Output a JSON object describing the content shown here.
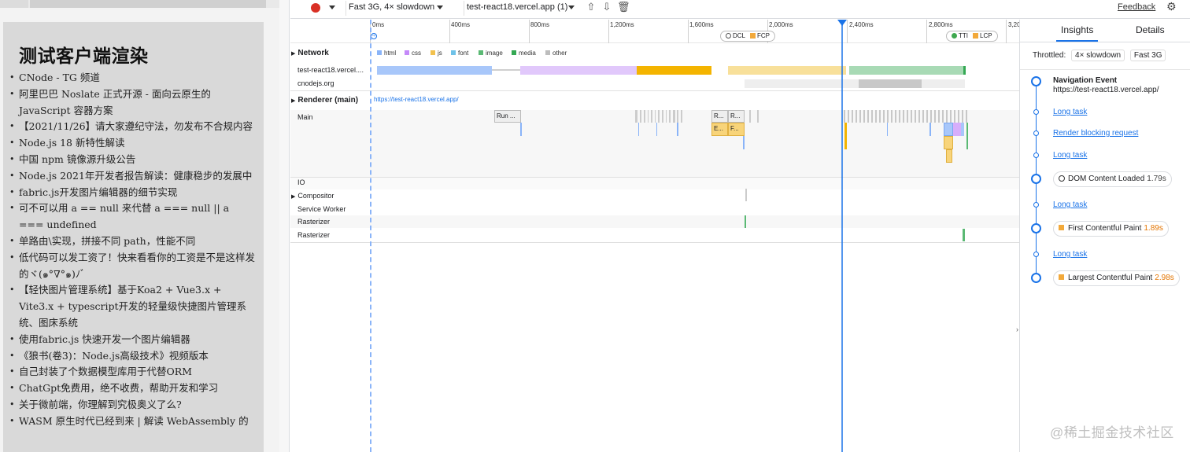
{
  "left_page": {
    "heading": "测试客户端渲染",
    "items": [
      "CNode - TG 频道",
      "阿里巴巴 Noslate 正式开源 - 面向云原生的 JavaScript 容器方案",
      "【2021/11/26】请大家遵纪守法，勿发布不合规内容",
      "Node.js 18 新特性解读",
      "中国 npm 镜像源升级公告",
      "Node.js 2021年开发者报告解读：健康稳步的发展中",
      "fabric.js开发图片编辑器的细节实现",
      "可不可以用 a == null 来代替 a === null || a === undefined",
      "单路由\\实现，拼接不同 path，性能不同",
      "低代码可以发工资了！快来看看你的工资是不是这样发的ヾ(๑°∇°๑)ﾉﾞ",
      "【轻快图片管理系统】基于Koa2 + Vue3.x + Vite3.x + typescript开发的轻量级快捷图片管理系统、图床系统",
      "使用fabric.js 快速开发一个图片编辑器",
      "《狼书(卷3)：Node.js高级技术》视频版本",
      "自己封装了个数据模型库用于代替ORM",
      "ChatGpt免费用，绝不收费，帮助开发和学习",
      "关于微前端，你理解到究极奥义了么?",
      "WASM 原生时代已经到来 | 解读 WebAssembly 的"
    ]
  },
  "toolbar": {
    "throttle_select": "Fast 3G, 4× slowdown",
    "target_select": "test-react18.vercel.app (1)",
    "feedback": "Feedback"
  },
  "ruler": {
    "ticks": [
      "0ms",
      "400ms",
      "800ms",
      "1,200ms",
      "1,600ms",
      "2,000ms",
      "2,400ms",
      "2,800ms",
      "3,20"
    ],
    "dcl_label": "DCL",
    "fcp_label": "FCP",
    "tti_label": "TTI",
    "lcp_label": "LCP"
  },
  "tracks": {
    "network_header": "Network",
    "legend": [
      "html",
      "css",
      "js",
      "font",
      "image",
      "media",
      "other"
    ],
    "legend_colors": [
      "#8ab4f8",
      "#c58af9",
      "#f2c14e",
      "#6fc2e8",
      "#5bb974",
      "#34a853",
      "#bdbdbd"
    ],
    "net_rows": [
      "test-react18.vercel....",
      "cnodejs.org"
    ],
    "renderer_header": "Renderer (main)",
    "renderer_url": "https://test-react18.vercel.app/",
    "main_label": "Main",
    "run_task": "Run ...",
    "r1": "R...",
    "r2": "R...",
    "e1": "E...",
    "f1": "F...",
    "other_rows": [
      "IO",
      "Compositor",
      "Service Worker",
      "Rasterizer",
      "Rasterizer"
    ]
  },
  "insights": {
    "tab_insights": "Insights",
    "tab_details": "Details",
    "throttled_label": "Throttled:",
    "cpu_chip": "4× slowdown",
    "net_chip": "Fast 3G",
    "nav_title": "Navigation Event",
    "nav_url": "https://test-react18.vercel.app/",
    "long_task": "Long task",
    "render_blocking": "Render blocking request",
    "dcl": {
      "label": "DOM Content Loaded",
      "time": "1.79s"
    },
    "fcp": {
      "label": "First Contentful Paint",
      "time": "1.89s"
    },
    "lcp": {
      "label": "Largest Contentful Paint",
      "time": "2.98s"
    }
  },
  "watermark": "@稀土掘金技术社区"
}
